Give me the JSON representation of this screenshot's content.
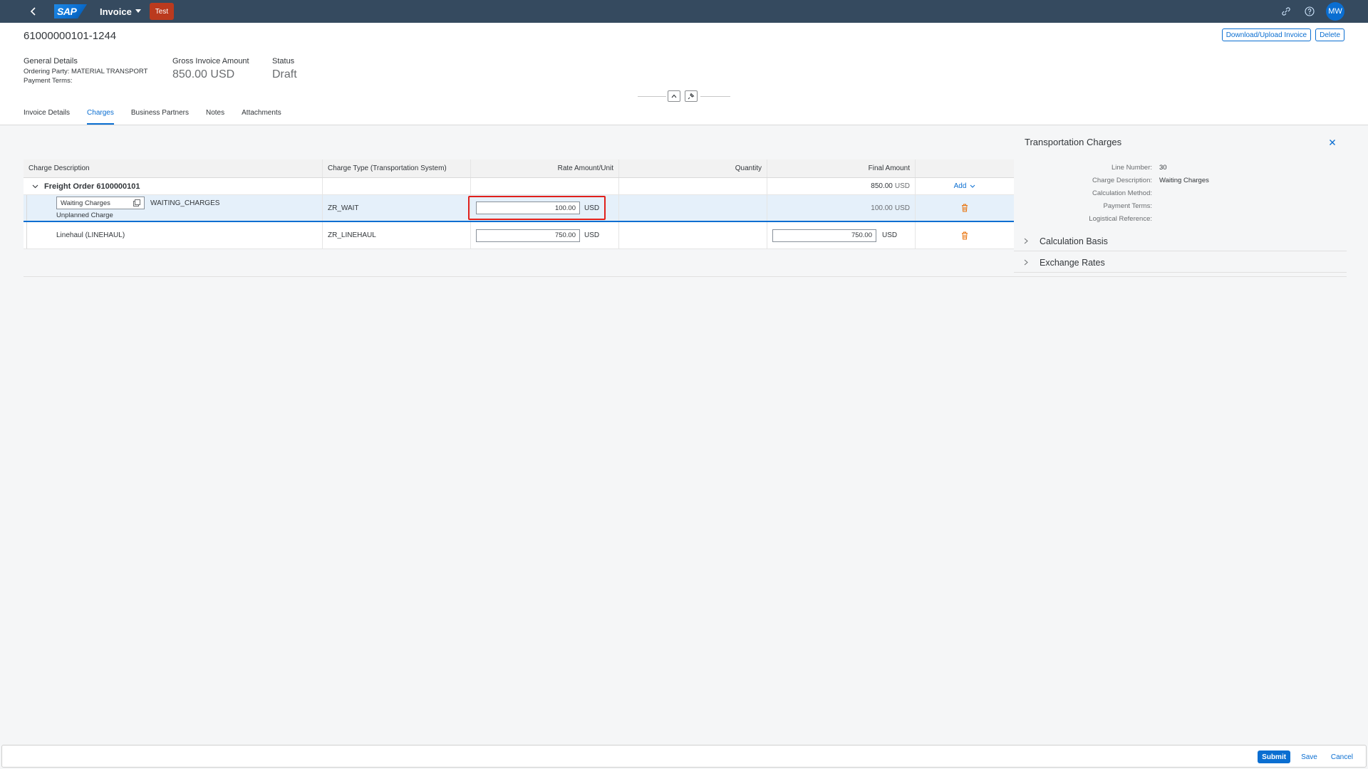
{
  "shell": {
    "app_title": "Invoice",
    "env_badge": "Test",
    "avatar_initials": "MW",
    "colors": {
      "bar": "#354a5f",
      "accent": "#0a6ed1",
      "badge": "#bb3a1e"
    },
    "icons": [
      "back-icon",
      "sap-logo",
      "chevron-down-icon",
      "link-icon",
      "help-icon",
      "avatar"
    ]
  },
  "header": {
    "title": "61000000101-1244",
    "actions": {
      "download_upload": "Download/Upload Invoice",
      "delete": "Delete"
    },
    "general": {
      "label": "General Details",
      "ordering_party": "Ordering Party: MATERIAL TRANSPORT",
      "payment_terms": "Payment Terms:"
    },
    "gross": {
      "label": "Gross Invoice Amount",
      "value": "850.00 USD"
    },
    "status": {
      "label": "Status",
      "value": "Draft"
    },
    "tabs": [
      {
        "label": "Invoice Details",
        "active": false
      },
      {
        "label": "Charges",
        "active": true
      },
      {
        "label": "Business Partners",
        "active": false
      },
      {
        "label": "Notes",
        "active": false
      },
      {
        "label": "Attachments",
        "active": false
      }
    ]
  },
  "table": {
    "columns": [
      "Charge Description",
      "Charge Type (Transportation System)",
      "Rate Amount/Unit",
      "Quantity",
      "Final Amount",
      ""
    ],
    "group": {
      "title": "Freight Order 6100000101",
      "final_amount": "850.00",
      "final_unit": "USD",
      "add_label": "Add"
    },
    "rows": [
      {
        "description_input": "Waiting Charges",
        "code": "WAITING_CHARGES",
        "sub": "Unplanned Charge",
        "charge_type": "ZR_WAIT",
        "rate": "100.00",
        "rate_unit": "USD",
        "final_amount": "100.00",
        "final_unit": "USD",
        "selected": true
      },
      {
        "description": "Linehaul (LINEHAUL)",
        "charge_type": "ZR_LINEHAUL",
        "rate": "750.00",
        "rate_unit": "USD",
        "final_input": "750.00",
        "final_unit": "USD",
        "selected": false
      }
    ]
  },
  "side_panel": {
    "title": "Transportation Charges",
    "fields": [
      {
        "label": "Line Number:",
        "value": "30"
      },
      {
        "label": "Charge Description:",
        "value": "Waiting Charges"
      },
      {
        "label": "Calculation Method:",
        "value": ""
      },
      {
        "label": "Payment Terms:",
        "value": ""
      },
      {
        "label": "Logistical Reference:",
        "value": ""
      }
    ],
    "sections": [
      "Calculation Basis",
      "Exchange Rates"
    ]
  },
  "footer": {
    "submit": "Submit",
    "save": "Save",
    "cancel": "Cancel"
  }
}
